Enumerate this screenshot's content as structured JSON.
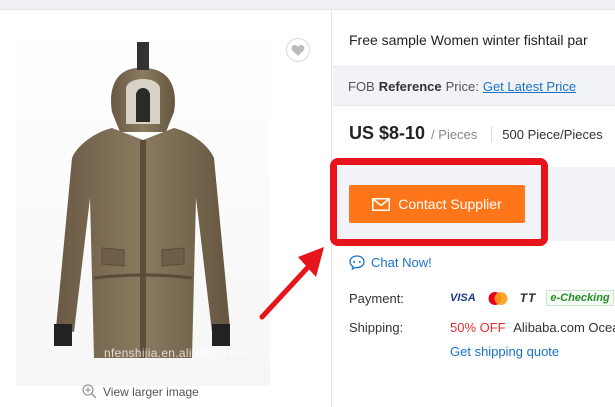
{
  "product": {
    "title": "Free sample Women winter fishtail par",
    "view_larger": "View larger image",
    "watermark": "nfenshijia.en.alibaba.com"
  },
  "pricing": {
    "fob_prefix": "FOB",
    "fob_reference": "Reference",
    "fob_suffix": "Price:",
    "latest_price_link": "Get Latest Price",
    "price": "US $8-10",
    "unit": "/ Pieces",
    "moq": "500 Piece/Pieces"
  },
  "actions": {
    "contact_supplier": "Contact Supplier",
    "chat_now": "Chat Now!"
  },
  "payment": {
    "label": "Payment:",
    "methods": [
      "VISA",
      "TT",
      "e-Checking"
    ]
  },
  "shipping": {
    "label": "Shipping:",
    "discount": "50% OFF",
    "destination": "Alibaba.com Ocea",
    "quote_link": "Get shipping quote"
  },
  "colors": {
    "accent_orange": "#ff7519",
    "highlight_red": "#e8141b",
    "link_blue": "#1a73c7",
    "jacket": "#7a6a52"
  },
  "icons": [
    "heart-icon",
    "zoom-icon",
    "mail-icon",
    "chat-icon",
    "mastercard-icon"
  ]
}
